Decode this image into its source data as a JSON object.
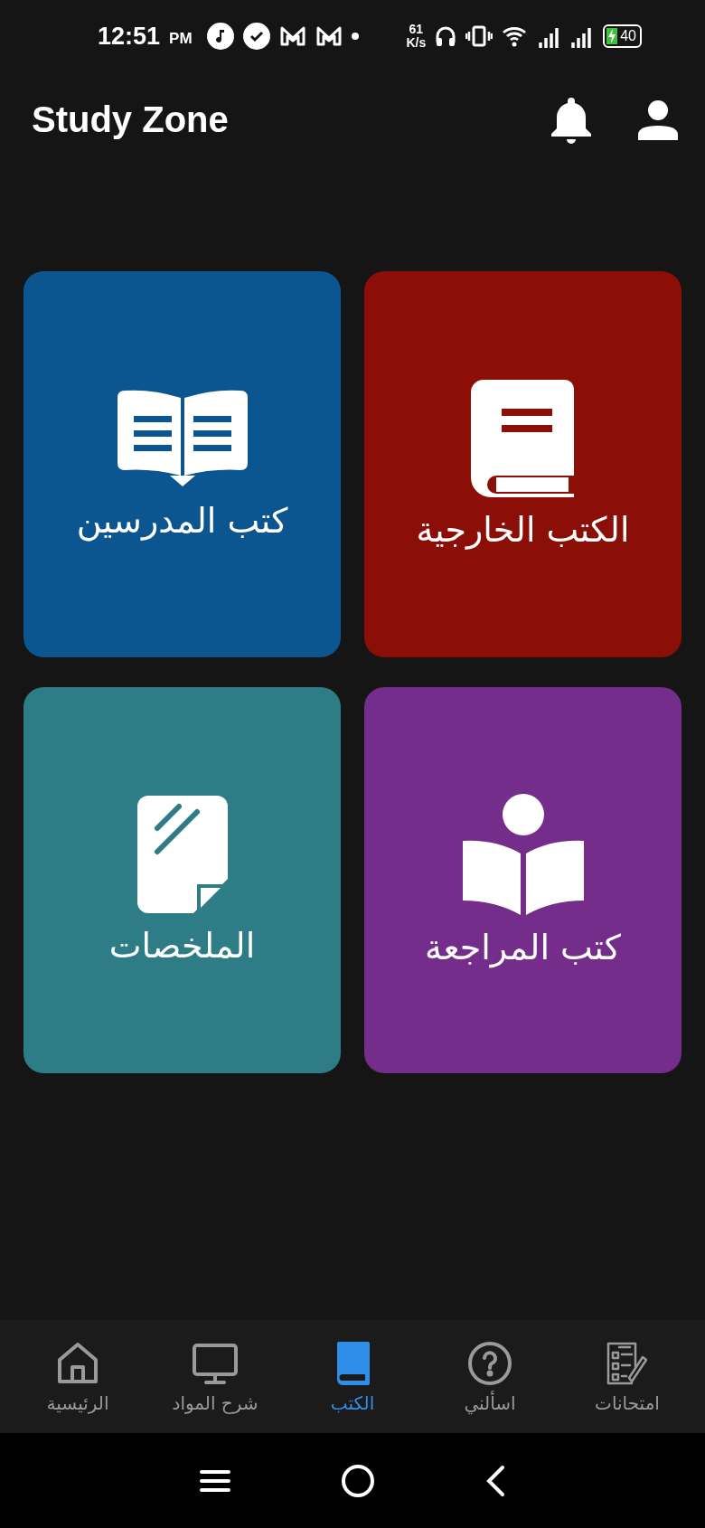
{
  "status_bar": {
    "time": "12:51",
    "meridiem": "PM",
    "speed_value": "61",
    "speed_unit": "K/s",
    "battery": "40",
    "charging": true
  },
  "header": {
    "title": "Study Zone"
  },
  "cards": [
    {
      "kind": "book",
      "label": "الكتب الخارجية",
      "color": "#8b0f06"
    },
    {
      "kind": "open-book",
      "label": "كتب المدرسين",
      "color": "#0b5690"
    },
    {
      "kind": "reader",
      "label": "كتب المراجعة",
      "color": "#742d8a"
    },
    {
      "kind": "note",
      "label": "الملخصات",
      "color": "#2e7c85"
    }
  ],
  "bottom_nav": [
    {
      "kind": "exams",
      "label": "امتحانات",
      "selected": false
    },
    {
      "kind": "question",
      "label": "اسألني",
      "selected": false
    },
    {
      "kind": "book",
      "label": "الكتب",
      "selected": true
    },
    {
      "kind": "monitor",
      "label": "شرح المواد",
      "selected": false
    },
    {
      "kind": "home",
      "label": "الرئيسية",
      "selected": false
    }
  ]
}
